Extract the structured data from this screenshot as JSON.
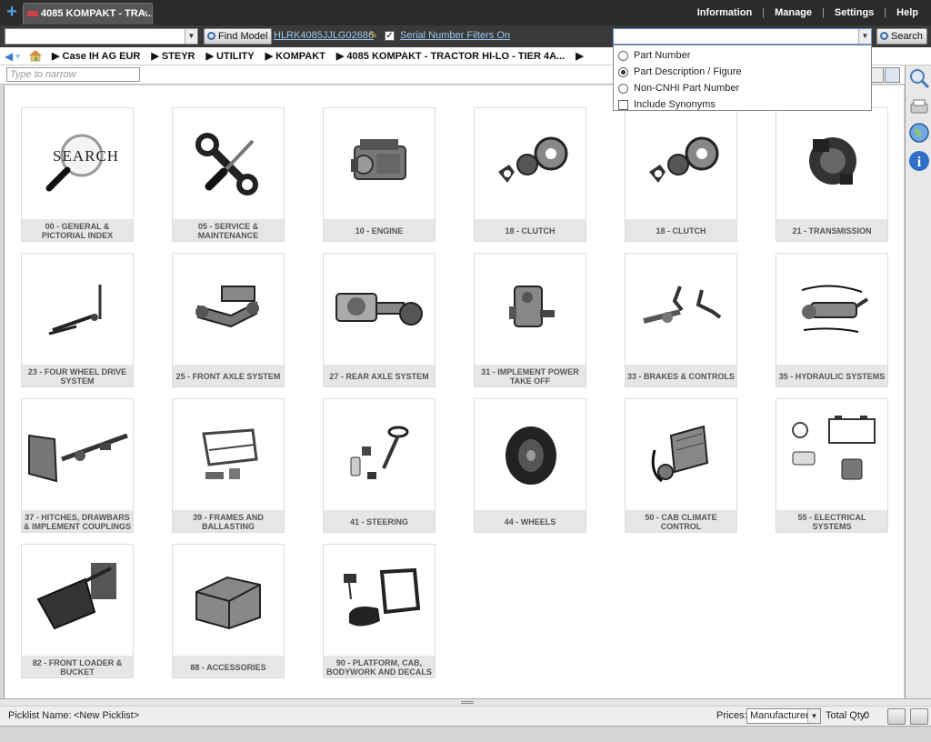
{
  "window": {
    "tab_title": "4085 KOMPAKT - TRA...",
    "tab_close": "×",
    "add_tab": "+"
  },
  "top_nav": {
    "items": [
      "Information",
      "Manage",
      "Settings",
      "Help"
    ]
  },
  "toolbar": {
    "model_combo_value": "",
    "find_model_label": "Find Model",
    "serial_number": "HLRK4085JJLG02686",
    "serial_filter_checked": true,
    "serial_filter_label": "Serial Number Filters On",
    "search_combo_value": "",
    "search_label": "Search"
  },
  "search_options": {
    "items": [
      {
        "label": "Part Number",
        "type": "radio",
        "selected": false
      },
      {
        "label": "Part Description / Figure",
        "type": "radio",
        "selected": true
      },
      {
        "label": "Non-CNHI Part Number",
        "type": "radio",
        "selected": false
      },
      {
        "label": "Include Synonyms",
        "type": "checkbox",
        "selected": false
      }
    ]
  },
  "breadcrumb": {
    "items": [
      "Case IH AG EUR",
      "STEYR",
      "UTILITY",
      "KOMPAKT",
      "4085 KOMPAKT - TRACTOR HI-LO - TIER 4A..."
    ]
  },
  "filter": {
    "placeholder": "Type to narrow"
  },
  "categories": [
    {
      "label": "00 - GENERAL & PICTORIAL INDEX",
      "icon": "search-icon"
    },
    {
      "label": "05 - SERVICE & MAINTENANCE",
      "icon": "tools-icon"
    },
    {
      "label": "10 - ENGINE",
      "icon": "engine-icon"
    },
    {
      "label": "18 - CLUTCH",
      "icon": "clutch-icon"
    },
    {
      "label": "18 - CLUTCH",
      "icon": "clutch-icon"
    },
    {
      "label": "21 - TRANSMISSION",
      "icon": "transmission-icon"
    },
    {
      "label": "23 - FOUR WHEEL DRIVE SYSTEM",
      "icon": "driveshaft-icon"
    },
    {
      "label": "25 - FRONT AXLE SYSTEM",
      "icon": "front-axle-icon"
    },
    {
      "label": "27 - REAR AXLE SYSTEM",
      "icon": "rear-axle-icon"
    },
    {
      "label": "31 - IMPLEMENT POWER TAKE OFF",
      "icon": "pto-icon"
    },
    {
      "label": "33 - BRAKES & CONTROLS",
      "icon": "brakes-icon"
    },
    {
      "label": "35 - HYDRAULIC SYSTEMS",
      "icon": "hydraulic-icon"
    },
    {
      "label": "37 - HITCHES, DRAWBARS & IMPLEMENT COUPLINGS",
      "icon": "hitch-icon"
    },
    {
      "label": "39 - FRAMES AND BALLASTING",
      "icon": "frame-icon"
    },
    {
      "label": "41 - STEERING",
      "icon": "steering-icon"
    },
    {
      "label": "44 - WHEELS",
      "icon": "wheel-icon"
    },
    {
      "label": "50 - CAB CLIMATE CONTROL",
      "icon": "climate-icon"
    },
    {
      "label": "55 - ELECTRICAL SYSTEMS",
      "icon": "electrical-icon"
    },
    {
      "label": "82 - FRONT LOADER & BUCKET",
      "icon": "loader-icon"
    },
    {
      "label": "88 - ACCESSORIES",
      "icon": "accessories-icon"
    },
    {
      "label": "90 - PLATFORM, CAB, BODYWORK AND DECALS",
      "icon": "cab-icon"
    }
  ],
  "footer": {
    "picklist_label": "Picklist Name:",
    "picklist_value": "<New Picklist>",
    "prices_label": "Prices:",
    "prices_value": "Manufacturer",
    "total_qty_label": "Total Qty:",
    "total_qty_value": "0"
  },
  "colors": {
    "topbar": "#2b2b2b",
    "link": "#9cc7ee",
    "accent": "#3a7ccc"
  }
}
